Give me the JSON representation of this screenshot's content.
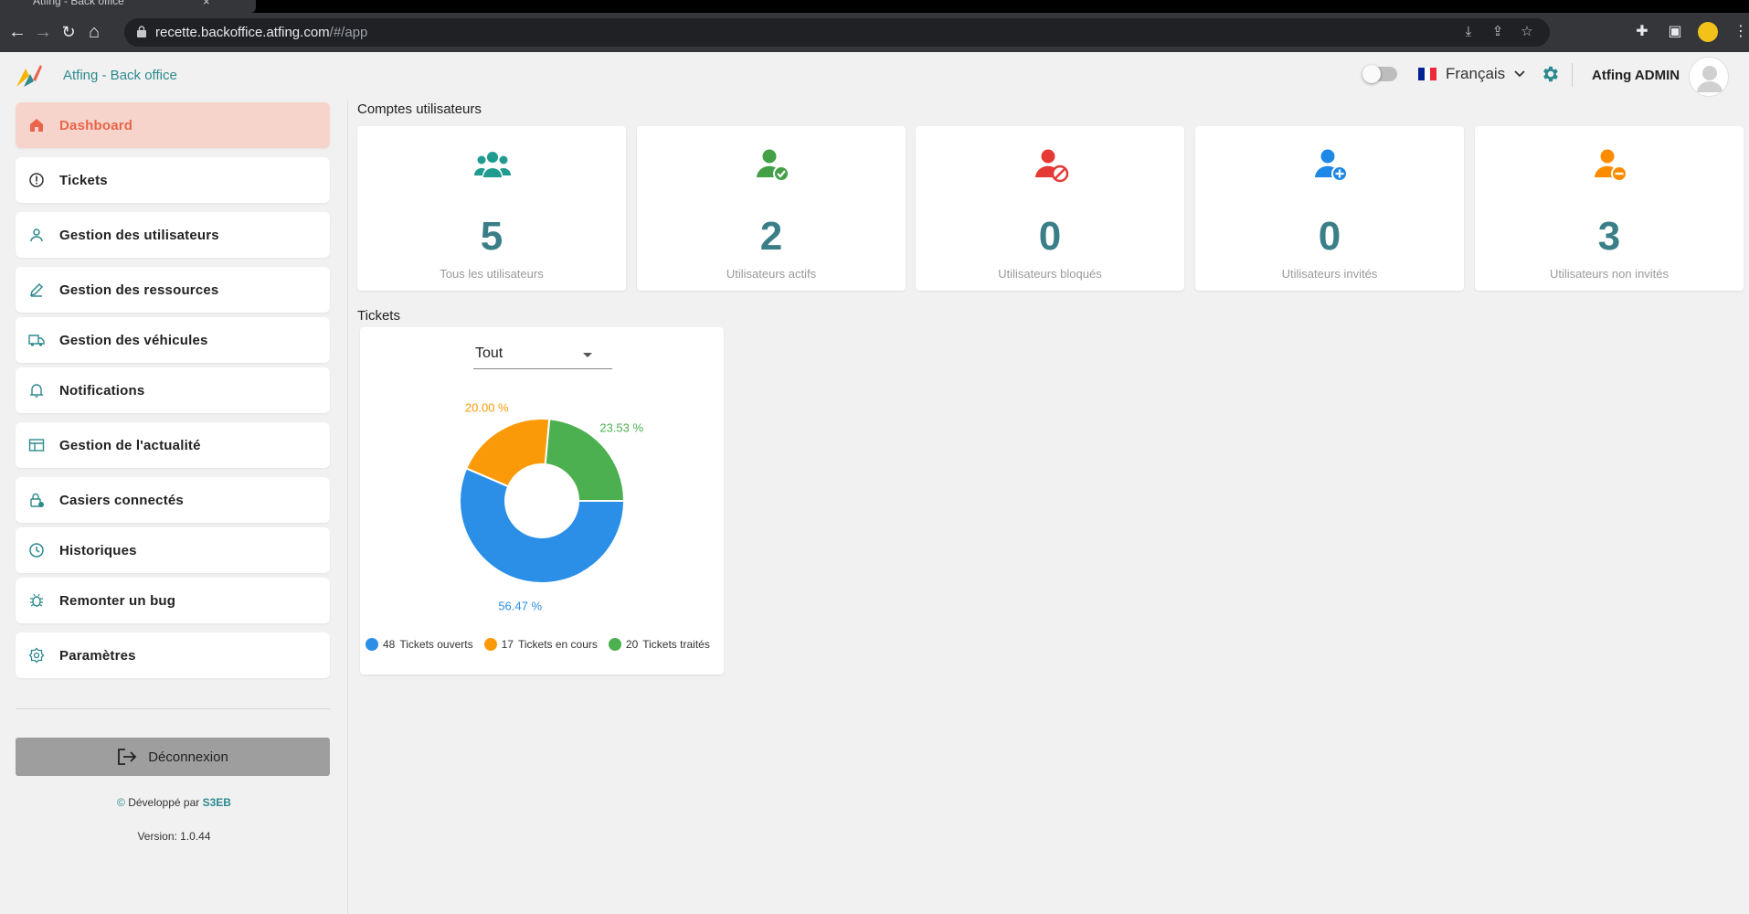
{
  "browser": {
    "tab_title": "Atfing - Back office",
    "url_host": "recette.backoffice.atfing.com",
    "url_path": "/#/app"
  },
  "header": {
    "app_title": "Atfing - Back office",
    "language": "Français",
    "user_name": "Atfing ADMIN"
  },
  "sidebar": {
    "items": [
      {
        "label": "Dashboard",
        "icon": "home-icon"
      },
      {
        "label": "Tickets",
        "icon": "alert-circle-icon"
      },
      {
        "label": "Gestion des utilisateurs",
        "icon": "user-icon"
      },
      {
        "label": "Gestion des ressources",
        "icon": "pencil-icon"
      },
      {
        "label": "Gestion des véhicules",
        "icon": "truck-icon"
      },
      {
        "label": "Notifications",
        "icon": "bell-icon"
      },
      {
        "label": "Gestion de l'actualité",
        "icon": "newspaper-icon"
      },
      {
        "label": "Casiers connectés",
        "icon": "lock-icon"
      },
      {
        "label": "Historiques",
        "icon": "clock-icon"
      },
      {
        "label": "Remonter un bug",
        "icon": "bug-icon"
      },
      {
        "label": "Paramètres",
        "icon": "settings-icon"
      }
    ],
    "logout_label": "Déconnexion",
    "developed_by": "Développé par",
    "developer_brand": "S3EB",
    "version": "Version: 1.0.44"
  },
  "accounts": {
    "title": "Comptes utilisateurs",
    "cards": [
      {
        "value": "5",
        "label": "Tous les utilisateurs",
        "color": "#1f9b8f",
        "icon": "users-group-icon"
      },
      {
        "value": "2",
        "label": "Utilisateurs actifs",
        "color": "#43a047",
        "icon": "user-check-icon"
      },
      {
        "value": "0",
        "label": "Utilisateurs bloqués",
        "color": "#e53935",
        "icon": "user-blocked-icon"
      },
      {
        "value": "0",
        "label": "Utilisateurs invités",
        "color": "#1e88e5",
        "icon": "user-plus-icon"
      },
      {
        "value": "3",
        "label": "Utilisateurs non invités",
        "color": "#fb8c00",
        "icon": "user-minus-icon"
      }
    ]
  },
  "tickets": {
    "title": "Tickets",
    "filter_value": "Tout"
  },
  "chart_data": {
    "type": "pie",
    "title": "",
    "series": [
      {
        "name": "Tickets ouverts",
        "value": 48,
        "percent_label": "56.47 %",
        "color": "#2b8fe8"
      },
      {
        "name": "Tickets en cours",
        "value": 17,
        "percent_label": "20.00 %",
        "color": "#fb9a08"
      },
      {
        "name": "Tickets traités",
        "value": 20,
        "percent_label": "23.53 %",
        "color": "#4caf50"
      }
    ],
    "legend_position": "bottom"
  }
}
